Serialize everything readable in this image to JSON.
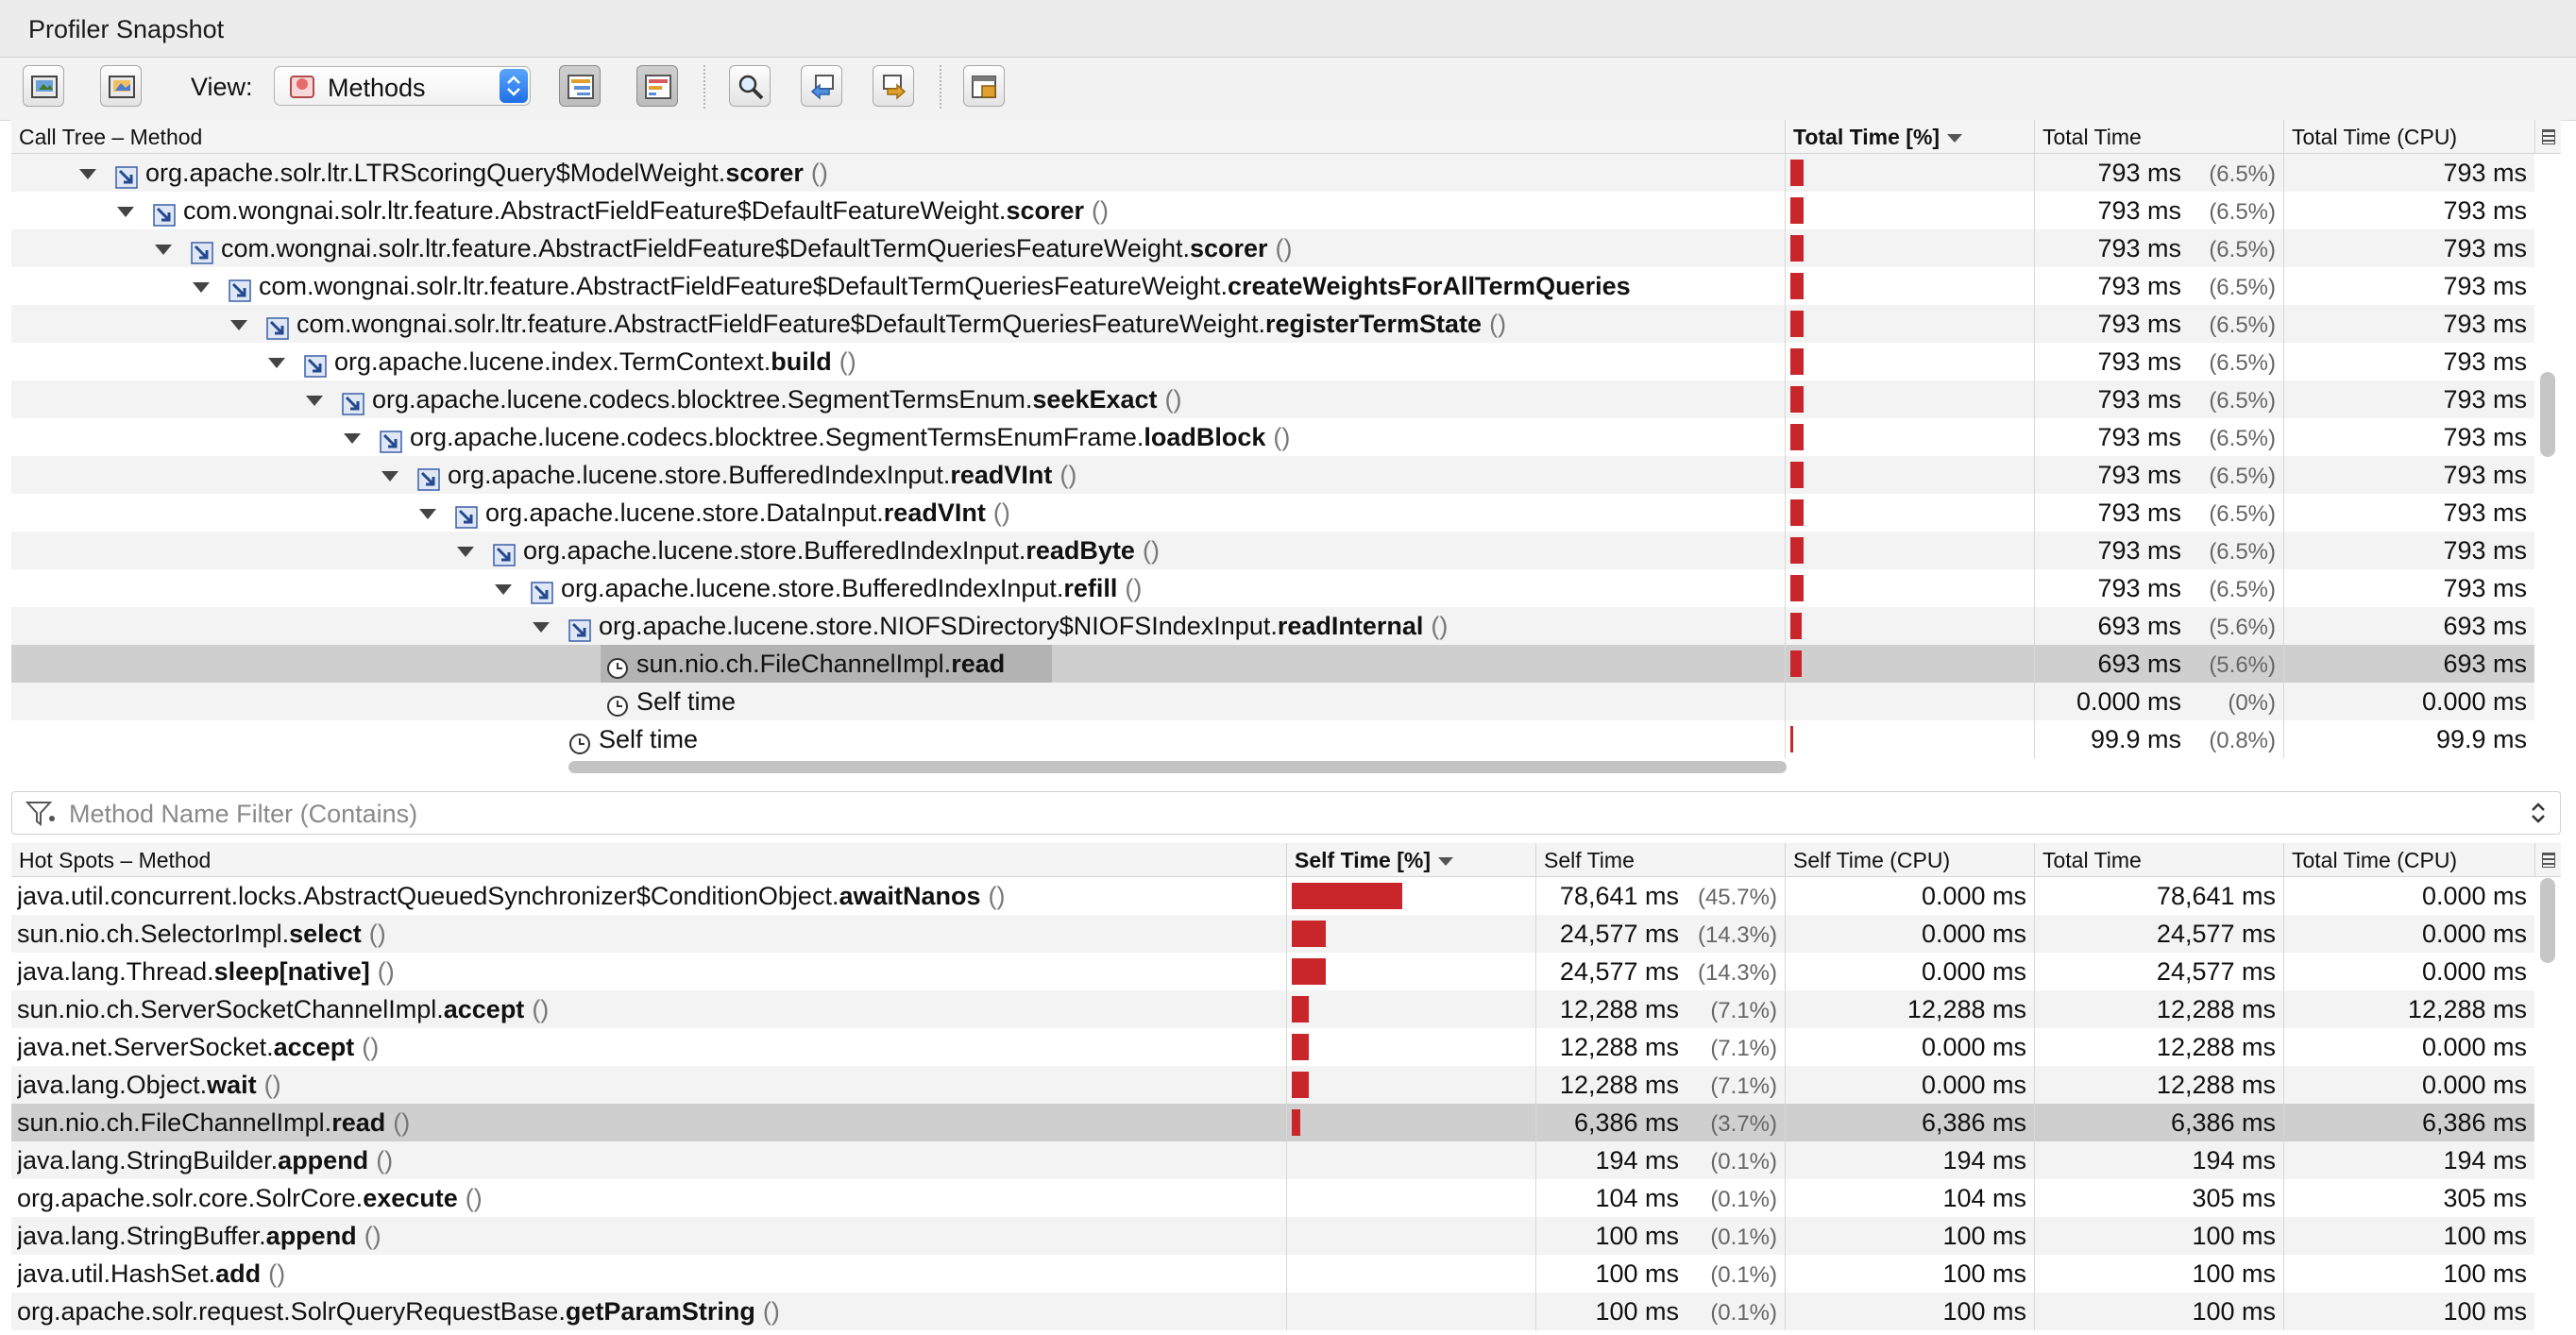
{
  "window": {
    "title": "Profiler Snapshot"
  },
  "toolbar": {
    "view_label": "View:",
    "view_value": "Methods",
    "buttons": [
      "export-icon",
      "save-image-icon",
      "call-tree-icon",
      "hot-spots-icon",
      "find-icon",
      "find-previous-icon",
      "find-next-icon",
      "info-icon"
    ]
  },
  "calltree": {
    "headers": {
      "method": "Call Tree – Method",
      "total_pct": "Total Time [%]",
      "total": "Total Time",
      "total_cpu": "Total Time (CPU)"
    },
    "rows": [
      {
        "level": 0,
        "kind": "method",
        "expanded": true,
        "pkg": "org.apache.solr.ltr.LTRScoringQuery$ModelWeight.",
        "name": "scorer",
        "paren": "()",
        "pct": 6.5,
        "total": "793 ms",
        "pct_text": "(6.5%)",
        "cpu": "793 ms"
      },
      {
        "level": 1,
        "kind": "method",
        "expanded": true,
        "pkg": "com.wongnai.solr.ltr.feature.AbstractFieldFeature$DefaultFeatureWeight.",
        "name": "scorer",
        "paren": "()",
        "pct": 6.5,
        "total": "793 ms",
        "pct_text": "(6.5%)",
        "cpu": "793 ms"
      },
      {
        "level": 2,
        "kind": "method",
        "expanded": true,
        "pkg": "com.wongnai.solr.ltr.feature.AbstractFieldFeature$DefaultTermQueriesFeatureWeight.",
        "name": "scorer",
        "paren": "()",
        "pct": 6.5,
        "total": "793 ms",
        "pct_text": "(6.5%)",
        "cpu": "793 ms"
      },
      {
        "level": 3,
        "kind": "method",
        "expanded": true,
        "pkg": "com.wongnai.solr.ltr.feature.AbstractFieldFeature$DefaultTermQueriesFeatureWeight.",
        "name": "createWeightsForAllTermQueries",
        "paren": "",
        "pct": 6.5,
        "total": "793 ms",
        "pct_text": "(6.5%)",
        "cpu": "793 ms"
      },
      {
        "level": 4,
        "kind": "method",
        "expanded": true,
        "pkg": "com.wongnai.solr.ltr.feature.AbstractFieldFeature$DefaultTermQueriesFeatureWeight.",
        "name": "registerTermState",
        "paren": "()",
        "pct": 6.5,
        "total": "793 ms",
        "pct_text": "(6.5%)",
        "cpu": "793 ms"
      },
      {
        "level": 5,
        "kind": "method",
        "expanded": true,
        "pkg": "org.apache.lucene.index.TermContext.",
        "name": "build",
        "paren": "()",
        "pct": 6.5,
        "total": "793 ms",
        "pct_text": "(6.5%)",
        "cpu": "793 ms"
      },
      {
        "level": 6,
        "kind": "method",
        "expanded": true,
        "pkg": "org.apache.lucene.codecs.blocktree.SegmentTermsEnum.",
        "name": "seekExact",
        "paren": "()",
        "pct": 6.5,
        "total": "793 ms",
        "pct_text": "(6.5%)",
        "cpu": "793 ms"
      },
      {
        "level": 7,
        "kind": "method",
        "expanded": true,
        "pkg": "org.apache.lucene.codecs.blocktree.SegmentTermsEnumFrame.",
        "name": "loadBlock",
        "paren": "()",
        "pct": 6.5,
        "total": "793 ms",
        "pct_text": "(6.5%)",
        "cpu": "793 ms"
      },
      {
        "level": 8,
        "kind": "method",
        "expanded": true,
        "pkg": "org.apache.lucene.store.BufferedIndexInput.",
        "name": "readVInt",
        "paren": "()",
        "pct": 6.5,
        "total": "793 ms",
        "pct_text": "(6.5%)",
        "cpu": "793 ms"
      },
      {
        "level": 9,
        "kind": "method",
        "expanded": true,
        "pkg": "org.apache.lucene.store.DataInput.",
        "name": "readVInt",
        "paren": "()",
        "pct": 6.5,
        "total": "793 ms",
        "pct_text": "(6.5%)",
        "cpu": "793 ms"
      },
      {
        "level": 10,
        "kind": "method",
        "expanded": true,
        "pkg": "org.apache.lucene.store.BufferedIndexInput.",
        "name": "readByte",
        "paren": "()",
        "pct": 6.5,
        "total": "793 ms",
        "pct_text": "(6.5%)",
        "cpu": "793 ms"
      },
      {
        "level": 11,
        "kind": "method",
        "expanded": true,
        "pkg": "org.apache.lucene.store.BufferedIndexInput.",
        "name": "refill",
        "paren": "()",
        "pct": 6.5,
        "total": "793 ms",
        "pct_text": "(6.5%)",
        "cpu": "793 ms"
      },
      {
        "level": 12,
        "kind": "method",
        "expanded": true,
        "pkg": "org.apache.lucene.store.NIOFSDirectory$NIOFSIndexInput.",
        "name": "readInternal",
        "paren": "()",
        "pct": 5.6,
        "total": "693 ms",
        "pct_text": "(5.6%)",
        "cpu": "693 ms"
      },
      {
        "level": 13,
        "kind": "clock",
        "selected": true,
        "pkg": "sun.nio.ch.FileChannelImpl.",
        "name": "read",
        "paren": "",
        "pct": 5.6,
        "total": "693 ms",
        "pct_text": "(5.6%)",
        "cpu": "693 ms"
      },
      {
        "level": 13,
        "kind": "clock",
        "self": true,
        "pkg": "Self time",
        "name": "",
        "paren": "",
        "pct": 0,
        "total": "0.000 ms",
        "pct_text": "(0%)",
        "cpu": "0.000 ms"
      },
      {
        "level": 12,
        "kind": "clock",
        "self": true,
        "pkg": "Self time",
        "name": "",
        "paren": "",
        "pct": 0.8,
        "total": "99.9 ms",
        "pct_text": "(0.8%)",
        "cpu": "99.9 ms"
      }
    ]
  },
  "filter": {
    "placeholder": "Method Name Filter (Contains)"
  },
  "hotspots": {
    "headers": {
      "method": "Hot Spots – Method",
      "self_pct": "Self Time [%]",
      "self": "Self Time",
      "self_cpu": "Self Time (CPU)",
      "total": "Total Time",
      "total_cpu": "Total Time (CPU)"
    },
    "rows": [
      {
        "pkg": "java.util.concurrent.locks.AbstractQueuedSynchronizer$ConditionObject.",
        "name": "awaitNanos",
        "paren": "()",
        "pct": 45.7,
        "self": "78,641 ms",
        "pct_text": "(45.7%)",
        "self_cpu": "0.000 ms",
        "total": "78,641 ms",
        "total_cpu": "0.000 ms"
      },
      {
        "pkg": "sun.nio.ch.SelectorImpl.",
        "name": "select",
        "paren": "()",
        "pct": 14.3,
        "self": "24,577 ms",
        "pct_text": "(14.3%)",
        "self_cpu": "0.000 ms",
        "total": "24,577 ms",
        "total_cpu": "0.000 ms"
      },
      {
        "pkg": "java.lang.Thread.",
        "name": "sleep[native]",
        "paren": "()",
        "pct": 14.3,
        "self": "24,577 ms",
        "pct_text": "(14.3%)",
        "self_cpu": "0.000 ms",
        "total": "24,577 ms",
        "total_cpu": "0.000 ms"
      },
      {
        "pkg": "sun.nio.ch.ServerSocketChannelImpl.",
        "name": "accept",
        "paren": "()",
        "pct": 7.1,
        "self": "12,288 ms",
        "pct_text": "(7.1%)",
        "self_cpu": "12,288 ms",
        "total": "12,288 ms",
        "total_cpu": "12,288 ms"
      },
      {
        "pkg": "java.net.ServerSocket.",
        "name": "accept",
        "paren": "()",
        "pct": 7.1,
        "self": "12,288 ms",
        "pct_text": "(7.1%)",
        "self_cpu": "0.000 ms",
        "total": "12,288 ms",
        "total_cpu": "0.000 ms"
      },
      {
        "pkg": "java.lang.Object.",
        "name": "wait",
        "paren": "()",
        "pct": 7.1,
        "self": "12,288 ms",
        "pct_text": "(7.1%)",
        "self_cpu": "0.000 ms",
        "total": "12,288 ms",
        "total_cpu": "0.000 ms"
      },
      {
        "pkg": "sun.nio.ch.FileChannelImpl.",
        "name": "read",
        "paren": "()",
        "pct": 3.7,
        "self": "6,386 ms",
        "pct_text": "(3.7%)",
        "self_cpu": "6,386 ms",
        "total": "6,386 ms",
        "total_cpu": "6,386 ms",
        "selected": true
      },
      {
        "pkg": "java.lang.StringBuilder.",
        "name": "append",
        "paren": "()",
        "pct": 0.1,
        "self": "194 ms",
        "pct_text": "(0.1%)",
        "self_cpu": "194 ms",
        "total": "194 ms",
        "total_cpu": "194 ms"
      },
      {
        "pkg": "org.apache.solr.core.SolrCore.",
        "name": "execute",
        "paren": "()",
        "pct": 0.1,
        "self": "104 ms",
        "pct_text": "(0.1%)",
        "self_cpu": "104 ms",
        "total": "305 ms",
        "total_cpu": "305 ms"
      },
      {
        "pkg": "java.lang.StringBuffer.",
        "name": "append",
        "paren": "()",
        "pct": 0.1,
        "self": "100 ms",
        "pct_text": "(0.1%)",
        "self_cpu": "100 ms",
        "total": "100 ms",
        "total_cpu": "100 ms"
      },
      {
        "pkg": "java.util.HashSet.",
        "name": "add",
        "paren": "()",
        "pct": 0.1,
        "self": "100 ms",
        "pct_text": "(0.1%)",
        "self_cpu": "100 ms",
        "total": "100 ms",
        "total_cpu": "100 ms"
      },
      {
        "pkg": "org.apache.solr.request.SolrQueryRequestBase.",
        "name": "getParamString",
        "paren": "()",
        "pct": 0.1,
        "self": "100 ms",
        "pct_text": "(0.1%)",
        "self_cpu": "100 ms",
        "total": "100 ms",
        "total_cpu": "100 ms"
      }
    ]
  },
  "colors": {
    "bar": "#c9262b",
    "selection": "#cfcfcf",
    "stripe": "#f3f3f3"
  }
}
